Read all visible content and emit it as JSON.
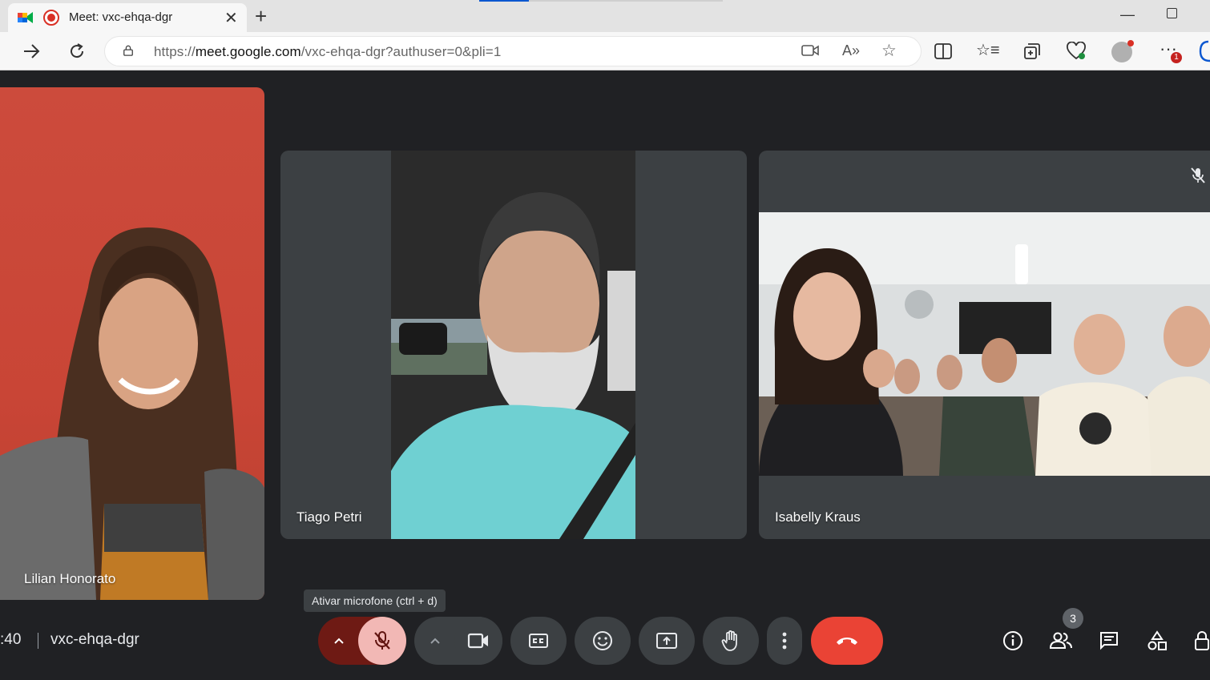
{
  "browser": {
    "tab_title": "Meet: vxc-ehqa-dgr",
    "url_scheme": "https://",
    "url_host": "meet.google.com",
    "url_path": "/vxc-ehqa-dgr?authuser=0&pli=1",
    "more_badge": "1"
  },
  "meeting": {
    "time_fragment": ":40",
    "code": "vxc-ehqa-dgr",
    "tooltip": "Ativar microfone (ctrl + d)",
    "participants_count": "3"
  },
  "participants": [
    {
      "name": "Lilian Honorato"
    },
    {
      "name": "Tiago Petri"
    },
    {
      "name": "Isabelly Kraus"
    }
  ],
  "colors": {
    "accent_end_call": "#ea4335",
    "mic_muted_bg": "#f2b8b5",
    "background": "#202124",
    "tile": "#3c4043"
  }
}
